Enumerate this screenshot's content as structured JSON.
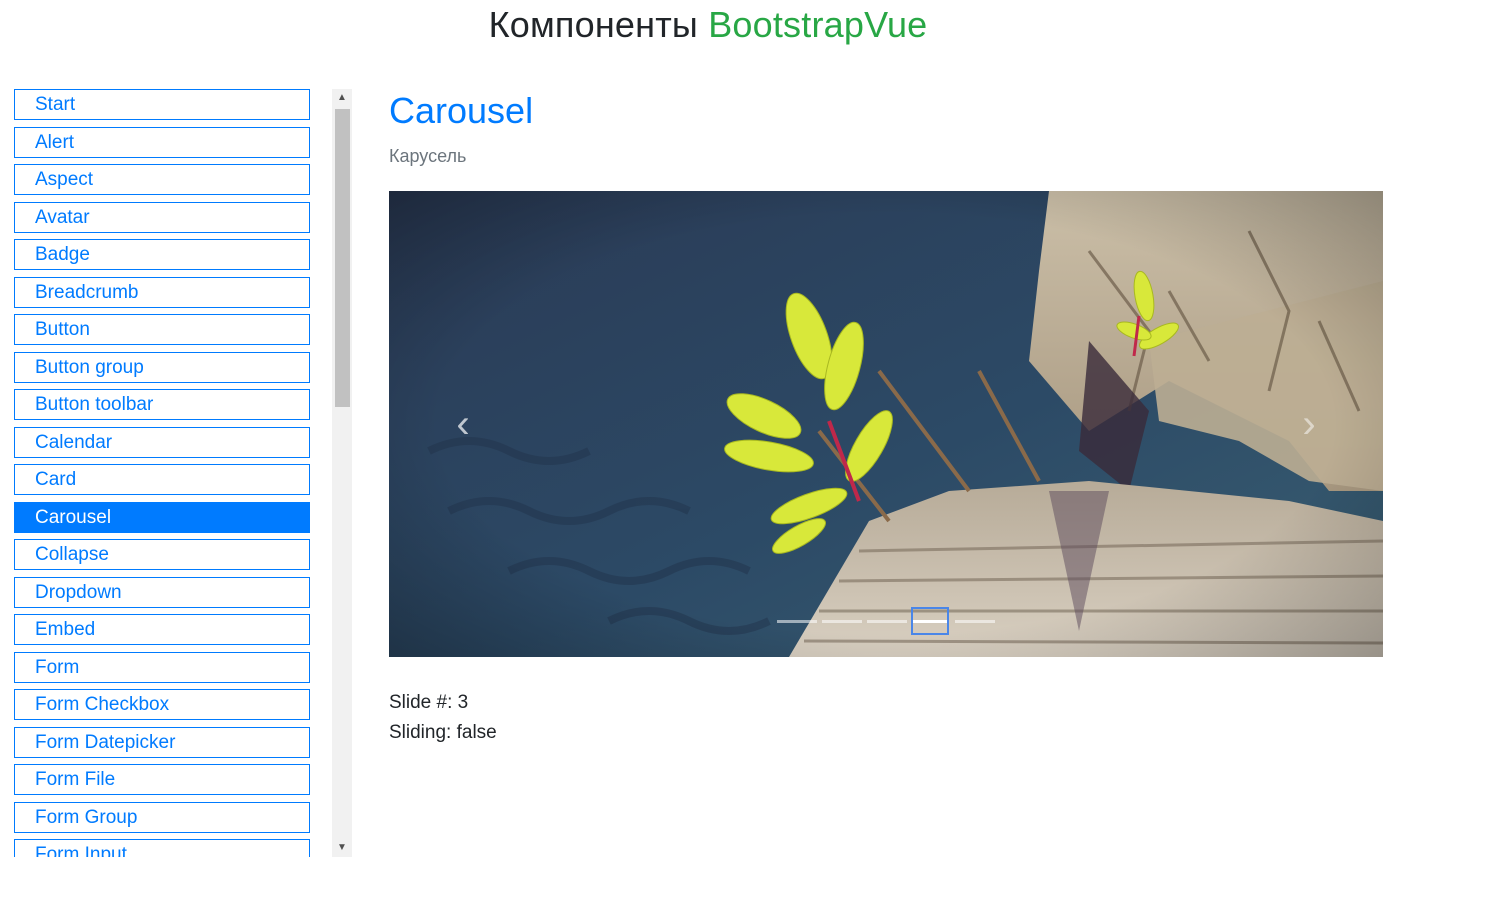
{
  "header": {
    "title_prefix": "Компоненты",
    "title_brand": "BootstrapVue"
  },
  "sidebar": {
    "items": [
      {
        "label": "Start"
      },
      {
        "label": "Alert"
      },
      {
        "label": "Aspect"
      },
      {
        "label": "Avatar"
      },
      {
        "label": "Badge"
      },
      {
        "label": "Breadcrumb"
      },
      {
        "label": "Button"
      },
      {
        "label": "Button group"
      },
      {
        "label": "Button toolbar"
      },
      {
        "label": "Calendar"
      },
      {
        "label": "Card"
      },
      {
        "label": "Carousel",
        "active": true
      },
      {
        "label": "Collapse"
      },
      {
        "label": "Dropdown"
      },
      {
        "label": "Embed"
      },
      {
        "label": "Form"
      },
      {
        "label": "Form Checkbox"
      },
      {
        "label": "Form Datepicker"
      },
      {
        "label": "Form File"
      },
      {
        "label": "Form Group"
      },
      {
        "label": "Form Input"
      }
    ]
  },
  "main": {
    "heading": "Carousel",
    "subtitle": "Карусель",
    "carousel": {
      "slide_count": 5,
      "active_index": 3,
      "prev_icon": "chevron-left-icon",
      "next_icon": "chevron-right-icon"
    },
    "status": {
      "slide_text": "Slide #: 3",
      "sliding_text": "Sliding: false"
    }
  },
  "colors": {
    "primary": "#007bff",
    "brand_green": "#28a745",
    "muted": "#6c757d",
    "text": "#212529"
  }
}
